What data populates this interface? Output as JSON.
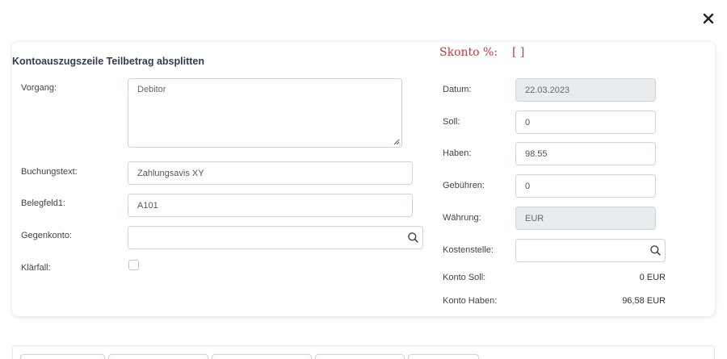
{
  "dialog": {
    "title": "Kontoauszugszeile Teilbetrag absplitten",
    "close_icon": "close-icon"
  },
  "skonto": {
    "label": "Skonto %:",
    "value": "[ ]"
  },
  "left": {
    "vorgang": {
      "label": "Vorgang:",
      "placeholder": "Debitor",
      "value": ""
    },
    "buchungstext": {
      "label": "Buchungstext:",
      "value": "Zahlungsavis XY"
    },
    "belegfeld1": {
      "label": "Belegfeld1:",
      "value": "A101"
    },
    "gegenkonto": {
      "label": "Gegenkonto:",
      "value": "",
      "icon": "search-icon"
    },
    "klaerfall": {
      "label": "Klärfall:",
      "checked": false
    }
  },
  "right": {
    "datum": {
      "label": "Datum:",
      "value": "22.03.2023"
    },
    "soll": {
      "label": "Soll:",
      "value": "0"
    },
    "haben": {
      "label": "Haben:",
      "value": "98.55"
    },
    "gebuehren": {
      "label": "Gebühren:",
      "value": "0"
    },
    "waehrung": {
      "label": "Währung:",
      "value": "EUR"
    },
    "kostenstelle": {
      "label": "Kostenstelle:",
      "value": "",
      "icon": "search-icon"
    },
    "konto_soll": {
      "label": "Konto Soll:",
      "value": "0 EUR"
    },
    "konto_haben": {
      "label": "Konto Haben:",
      "value": "96,58 EUR"
    }
  },
  "colors": {
    "skonto": "#d0333a",
    "title": "#333d4d",
    "disabled_bg": "#e9ecef",
    "border": "#cfd4da"
  }
}
